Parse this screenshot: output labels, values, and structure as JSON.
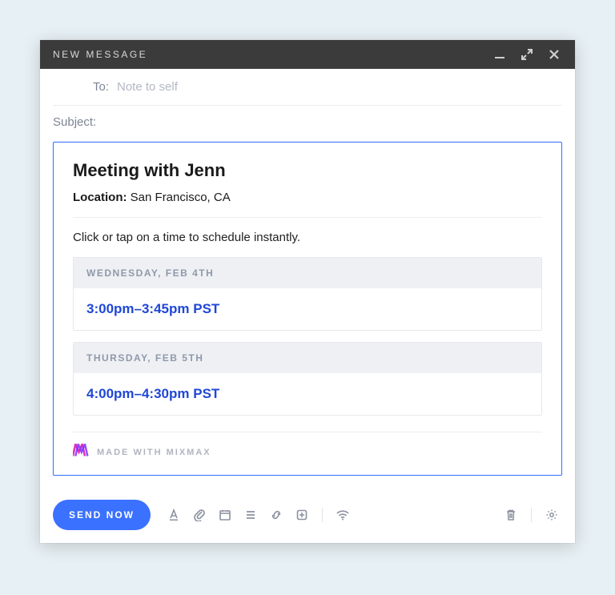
{
  "titlebar": {
    "title": "NEW MESSAGE"
  },
  "fields": {
    "to_label": "To:",
    "to_value": "Note to self",
    "subject_label": "Subject:"
  },
  "card": {
    "title": "Meeting with Jenn",
    "location_label": "Location:",
    "location_value": "San Francisco, CA",
    "instructions": "Click or tap on a time to schedule instantly.",
    "slots": [
      {
        "day": "WEDNESDAY, FEB 4TH",
        "time": "3:00pm–3:45pm PST"
      },
      {
        "day": "THURSDAY, FEB 5TH",
        "time": "4:00pm–4:30pm PST"
      }
    ],
    "made_with": "MADE WITH MIXMAX"
  },
  "footer": {
    "send_label": "SEND NOW"
  }
}
